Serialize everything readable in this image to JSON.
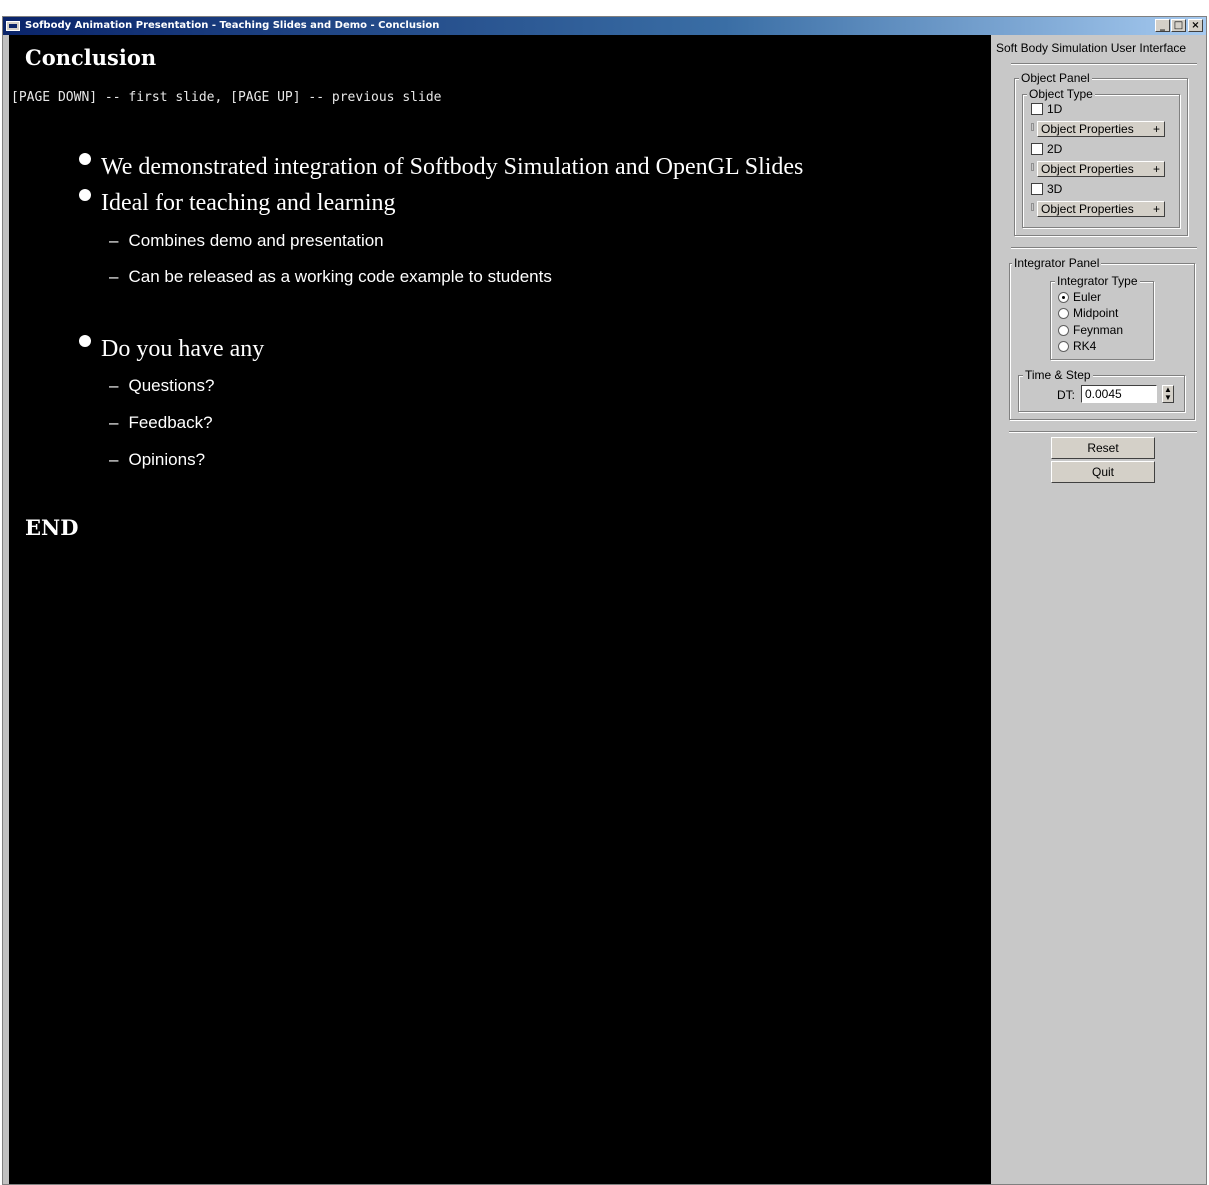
{
  "window": {
    "title": "Sofbody Animation Presentation - Teaching Slides and Demo - Conclusion",
    "minimize": "_",
    "maximize": "□",
    "close": "×"
  },
  "slide": {
    "title": "Conclusion",
    "nav_hint": "[PAGE DOWN] -- first slide, [PAGE UP] -- previous slide",
    "bullets": [
      "We demonstrated integration of Softbody Simulation and OpenGL Slides",
      "Ideal for teaching and learning",
      "Do you have any"
    ],
    "subs": [
      "Combines demo and presentation",
      "Can be released as a working code example to students",
      "Questions?",
      "Feedback?",
      "Opinions?"
    ],
    "dash": "–",
    "end": "END"
  },
  "panel": {
    "title": "Soft Body Simulation User Interface",
    "object_panel": {
      "label": "Object Panel",
      "object_type_label": "Object Type",
      "items": [
        {
          "label": "1D",
          "checked": false,
          "button": "Object Properties",
          "plus": "+"
        },
        {
          "label": "2D",
          "checked": false,
          "button": "Object Properties",
          "plus": "+"
        },
        {
          "label": "3D",
          "checked": false,
          "button": "Object Properties",
          "plus": "+"
        }
      ]
    },
    "integrator_panel": {
      "label": "Integrator Panel",
      "type_label": "Integrator Type",
      "options": [
        "Euler",
        "Midpoint",
        "Feynman",
        "RK4"
      ],
      "selected": "Euler",
      "time_step_label": "Time & Step",
      "dt_label": "DT:",
      "dt_value": "0.0045"
    },
    "reset_label": "Reset",
    "quit_label": "Quit"
  }
}
